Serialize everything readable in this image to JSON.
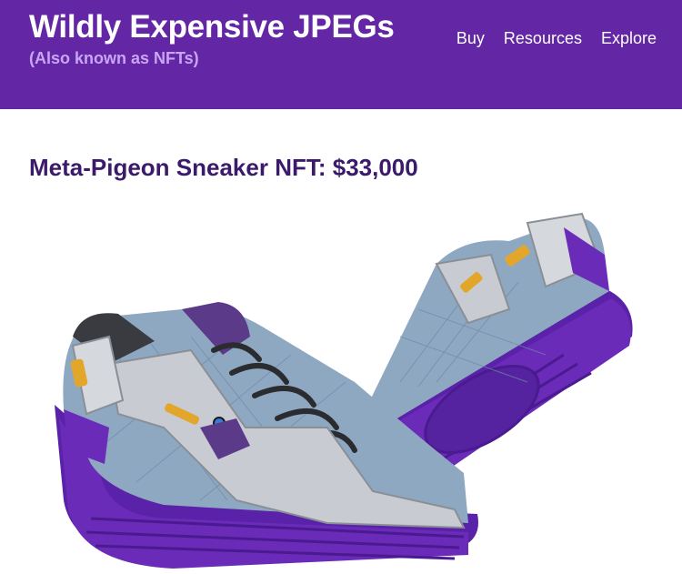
{
  "header": {
    "title": "Wildly Expensive JPEGs",
    "subtitle": "(Also known as NFTs)",
    "nav": [
      "Buy",
      "Resources",
      "Explore"
    ]
  },
  "product": {
    "title": "Meta-Pigeon Sneaker NFT: $33,000",
    "image_icon": "sneaker-pair-image",
    "colors": {
      "brand": "#6326a4",
      "sole": "#6a2bb8",
      "quilted_panel": "#8fa8c2",
      "chrome": "#c8ccd2",
      "accent": "#e2a72a"
    }
  }
}
